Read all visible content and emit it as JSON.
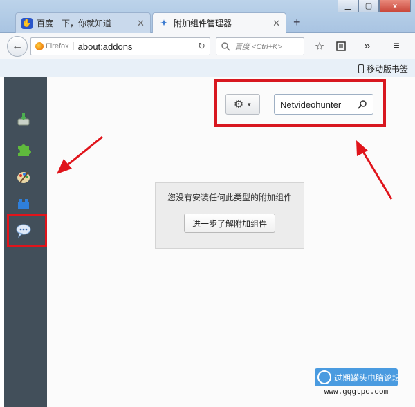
{
  "window": {
    "minimize_icon": "minimize-icon",
    "maximize_icon": "maximize-icon",
    "close_glyph": "x"
  },
  "tabs": [
    {
      "label": "百度一下，你就知道",
      "icon": "baidu-paw-icon",
      "active": false
    },
    {
      "label": "附加组件管理器",
      "icon": "puzzle-piece-icon",
      "active": true
    }
  ],
  "navbar": {
    "identity_label": "Firefox",
    "url": "about:addons",
    "search_placeholder": "百度 <Ctrl+K>"
  },
  "bookmarks_bar": {
    "mobile_bookmarks_label": "移动版书签"
  },
  "sidebar": {
    "categories": [
      {
        "name": "get-addons",
        "icon": "download-box-icon"
      },
      {
        "name": "extensions",
        "icon": "puzzle-piece-icon"
      },
      {
        "name": "appearance",
        "icon": "paint-palette-icon"
      },
      {
        "name": "plugins",
        "icon": "lego-brick-icon"
      },
      {
        "name": "services",
        "icon": "chat-bubble-icon",
        "selected": true
      }
    ]
  },
  "main": {
    "search_value": "Netvideohunter",
    "empty_message": "您没有安装任何此类型的附加组件",
    "learn_more_label": "进一步了解附加组件"
  },
  "watermark": {
    "title": "过期罐头电脑论坛",
    "url": "www.gqgtpc.com"
  },
  "colors": {
    "annotation_red": "#d81820",
    "sidebar_bg": "#424f5a",
    "accent_blue": "#3b7bd0"
  }
}
